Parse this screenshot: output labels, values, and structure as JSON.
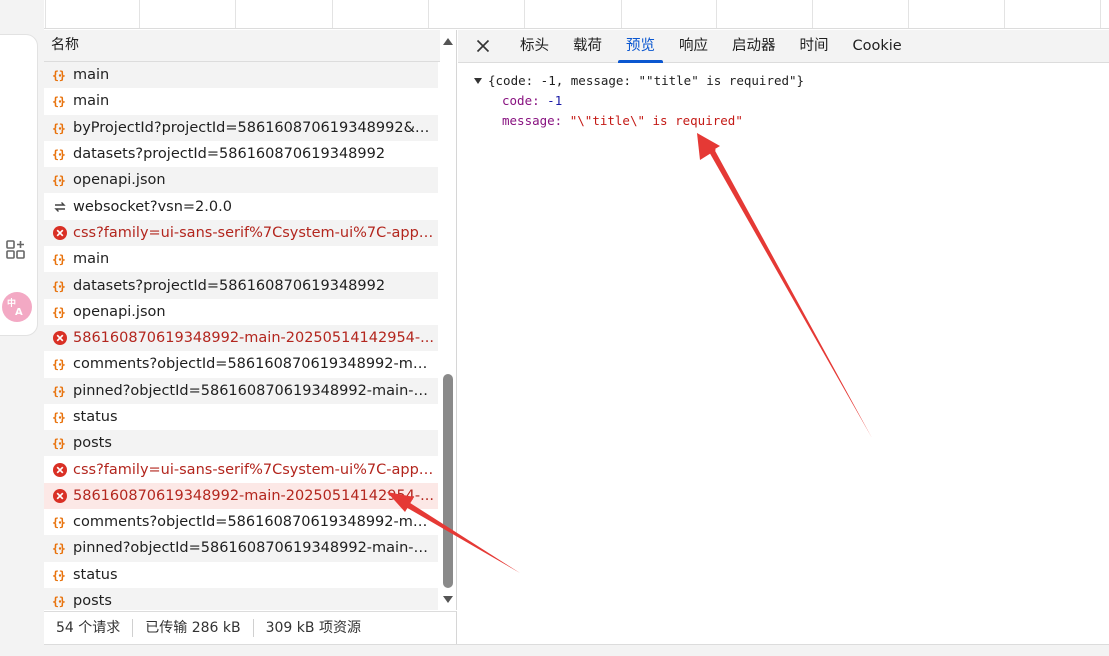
{
  "list": {
    "header": "名称",
    "rows": [
      {
        "name": "main",
        "type": "json",
        "status": "ok"
      },
      {
        "name": "main",
        "type": "json",
        "status": "ok"
      },
      {
        "name": "byProjectId?projectId=586160870619348992&p...",
        "type": "json",
        "status": "ok"
      },
      {
        "name": "datasets?projectId=586160870619348992",
        "type": "json",
        "status": "ok"
      },
      {
        "name": "openapi.json",
        "type": "json",
        "status": "ok"
      },
      {
        "name": "websocket?vsn=2.0.0",
        "type": "websocket",
        "status": "ok"
      },
      {
        "name": "css?family=ui-sans-serif%7Csystem-ui%7C-appl...",
        "type": "error",
        "status": "error"
      },
      {
        "name": "main",
        "type": "json",
        "status": "ok"
      },
      {
        "name": "datasets?projectId=586160870619348992",
        "type": "json",
        "status": "ok"
      },
      {
        "name": "openapi.json",
        "type": "json",
        "status": "ok"
      },
      {
        "name": "586160870619348992-main-20250514142954-...",
        "type": "error",
        "status": "error"
      },
      {
        "name": "comments?objectId=586160870619348992-mai...",
        "type": "json",
        "status": "ok"
      },
      {
        "name": "pinned?objectId=586160870619348992-main-2...",
        "type": "json",
        "status": "ok"
      },
      {
        "name": "status",
        "type": "json",
        "status": "ok"
      },
      {
        "name": "posts",
        "type": "json",
        "status": "ok"
      },
      {
        "name": "css?family=ui-sans-serif%7Csystem-ui%7C-appl...",
        "type": "error",
        "status": "error"
      },
      {
        "name": "586160870619348992-main-20250514142954-...",
        "type": "error",
        "status": "selected"
      },
      {
        "name": "comments?objectId=586160870619348992-mai...",
        "type": "json",
        "status": "ok"
      },
      {
        "name": "pinned?objectId=586160870619348992-main-2...",
        "type": "json",
        "status": "ok"
      },
      {
        "name": "status",
        "type": "json",
        "status": "ok"
      },
      {
        "name": "posts",
        "type": "json",
        "status": "ok"
      }
    ]
  },
  "statusbar": {
    "requests": "54 个请求",
    "transferred": "已传输 286 kB",
    "resources": "309 kB 项资源"
  },
  "detail": {
    "tabs": [
      {
        "label": "标头",
        "active": false
      },
      {
        "label": "载荷",
        "active": false
      },
      {
        "label": "预览",
        "active": true
      },
      {
        "label": "响应",
        "active": false
      },
      {
        "label": "启动器",
        "active": false
      },
      {
        "label": "时间",
        "active": false
      },
      {
        "label": "Cookie",
        "active": false
      }
    ],
    "preview": {
      "summary": "{code: -1, message: \"\"title\" is required\"}",
      "code_key": "code:",
      "code_value": "-1",
      "message_key": "message:",
      "message_value": "\"\\\"title\\\" is required\""
    }
  },
  "icons": {
    "json": "json-braces-icon",
    "websocket": "websocket-icon",
    "error": "error-circle-icon",
    "close": "close-icon"
  },
  "colors": {
    "accent": "#0b57d0",
    "error": "#b3261e",
    "selected_bg": "#fce8e6",
    "json_icon": "#e8710a",
    "arrow": "#e53935"
  }
}
